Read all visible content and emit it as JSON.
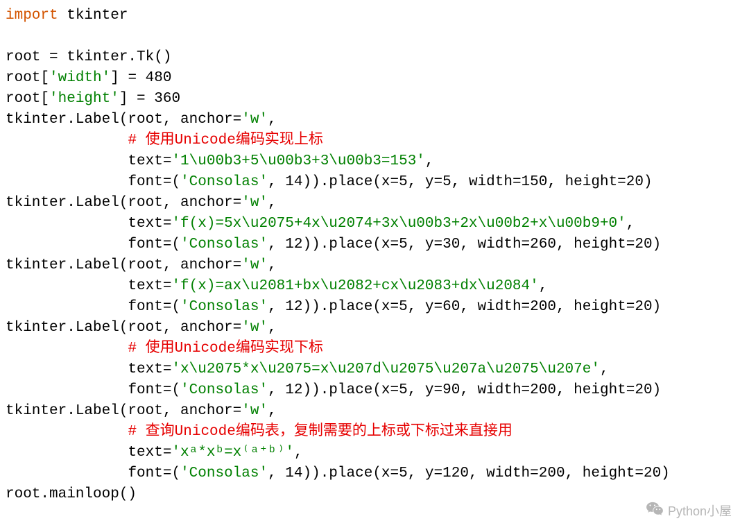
{
  "code": {
    "line1_kw": "import",
    "line1_rest": " tkinter",
    "line2": "",
    "line3_a": "root = tkinter.Tk()",
    "line4_a": "root[",
    "line4_s": "'width'",
    "line4_b": "] = 480",
    "line5_a": "root[",
    "line5_s": "'height'",
    "line5_b": "] = 360",
    "line6_a": "tkinter.Label(root, anchor=",
    "line6_s": "'w'",
    "line6_b": ",",
    "indent": "              ",
    "line7_c": "# 使用Unicode编码实现上标",
    "line8_a": "text=",
    "line8_s": "'1\\u00b3+5\\u00b3+3\\u00b3=153'",
    "line8_b": ",",
    "line9_a": "font=(",
    "line9_s": "'Consolas'",
    "line9_b": ", 14)).place(x=5, y=5, width=150, height=20)",
    "line10_a": "tkinter.Label(root, anchor=",
    "line10_s": "'w'",
    "line10_b": ",",
    "line11_a": "text=",
    "line11_s": "'f(x)=5x\\u2075+4x\\u2074+3x\\u00b3+2x\\u00b2+x\\u00b9+0'",
    "line11_b": ",",
    "line12_a": "font=(",
    "line12_s": "'Consolas'",
    "line12_b": ", 12)).place(x=5, y=30, width=260, height=20)",
    "line13_a": "tkinter.Label(root, anchor=",
    "line13_s": "'w'",
    "line13_b": ",",
    "line14_a": "text=",
    "line14_s": "'f(x)=ax\\u2081+bx\\u2082+cx\\u2083+dx\\u2084'",
    "line14_b": ",",
    "line15_a": "font=(",
    "line15_s": "'Consolas'",
    "line15_b": ", 12)).place(x=5, y=60, width=200, height=20)",
    "line16_a": "tkinter.Label(root, anchor=",
    "line16_s": "'w'",
    "line16_b": ",",
    "line17_c": "# 使用Unicode编码实现下标",
    "line18_a": "text=",
    "line18_s": "'x\\u2075*x\\u2075=x\\u207d\\u2075\\u207a\\u2075\\u207e'",
    "line18_b": ",",
    "line19_a": "font=(",
    "line19_s": "'Consolas'",
    "line19_b": ", 12)).place(x=5, y=90, width=200, height=20)",
    "line20_a": "tkinter.Label(root, anchor=",
    "line20_s": "'w'",
    "line20_b": ",",
    "line21_c": "# 查询Unicode编码表，复制需要的上标或下标过来直接用",
    "line22_a": "text=",
    "line22_s": "'xᵃ*xᵇ=x⁽ᵃ⁺ᵇ⁾'",
    "line22_b": ",",
    "line23_a": "font=(",
    "line23_s": "'Consolas'",
    "line23_b": ", 14)).place(x=5, y=120, width=200, height=20)",
    "line24": "root.mainloop()"
  },
  "watermark": {
    "text": "Python小屋"
  }
}
